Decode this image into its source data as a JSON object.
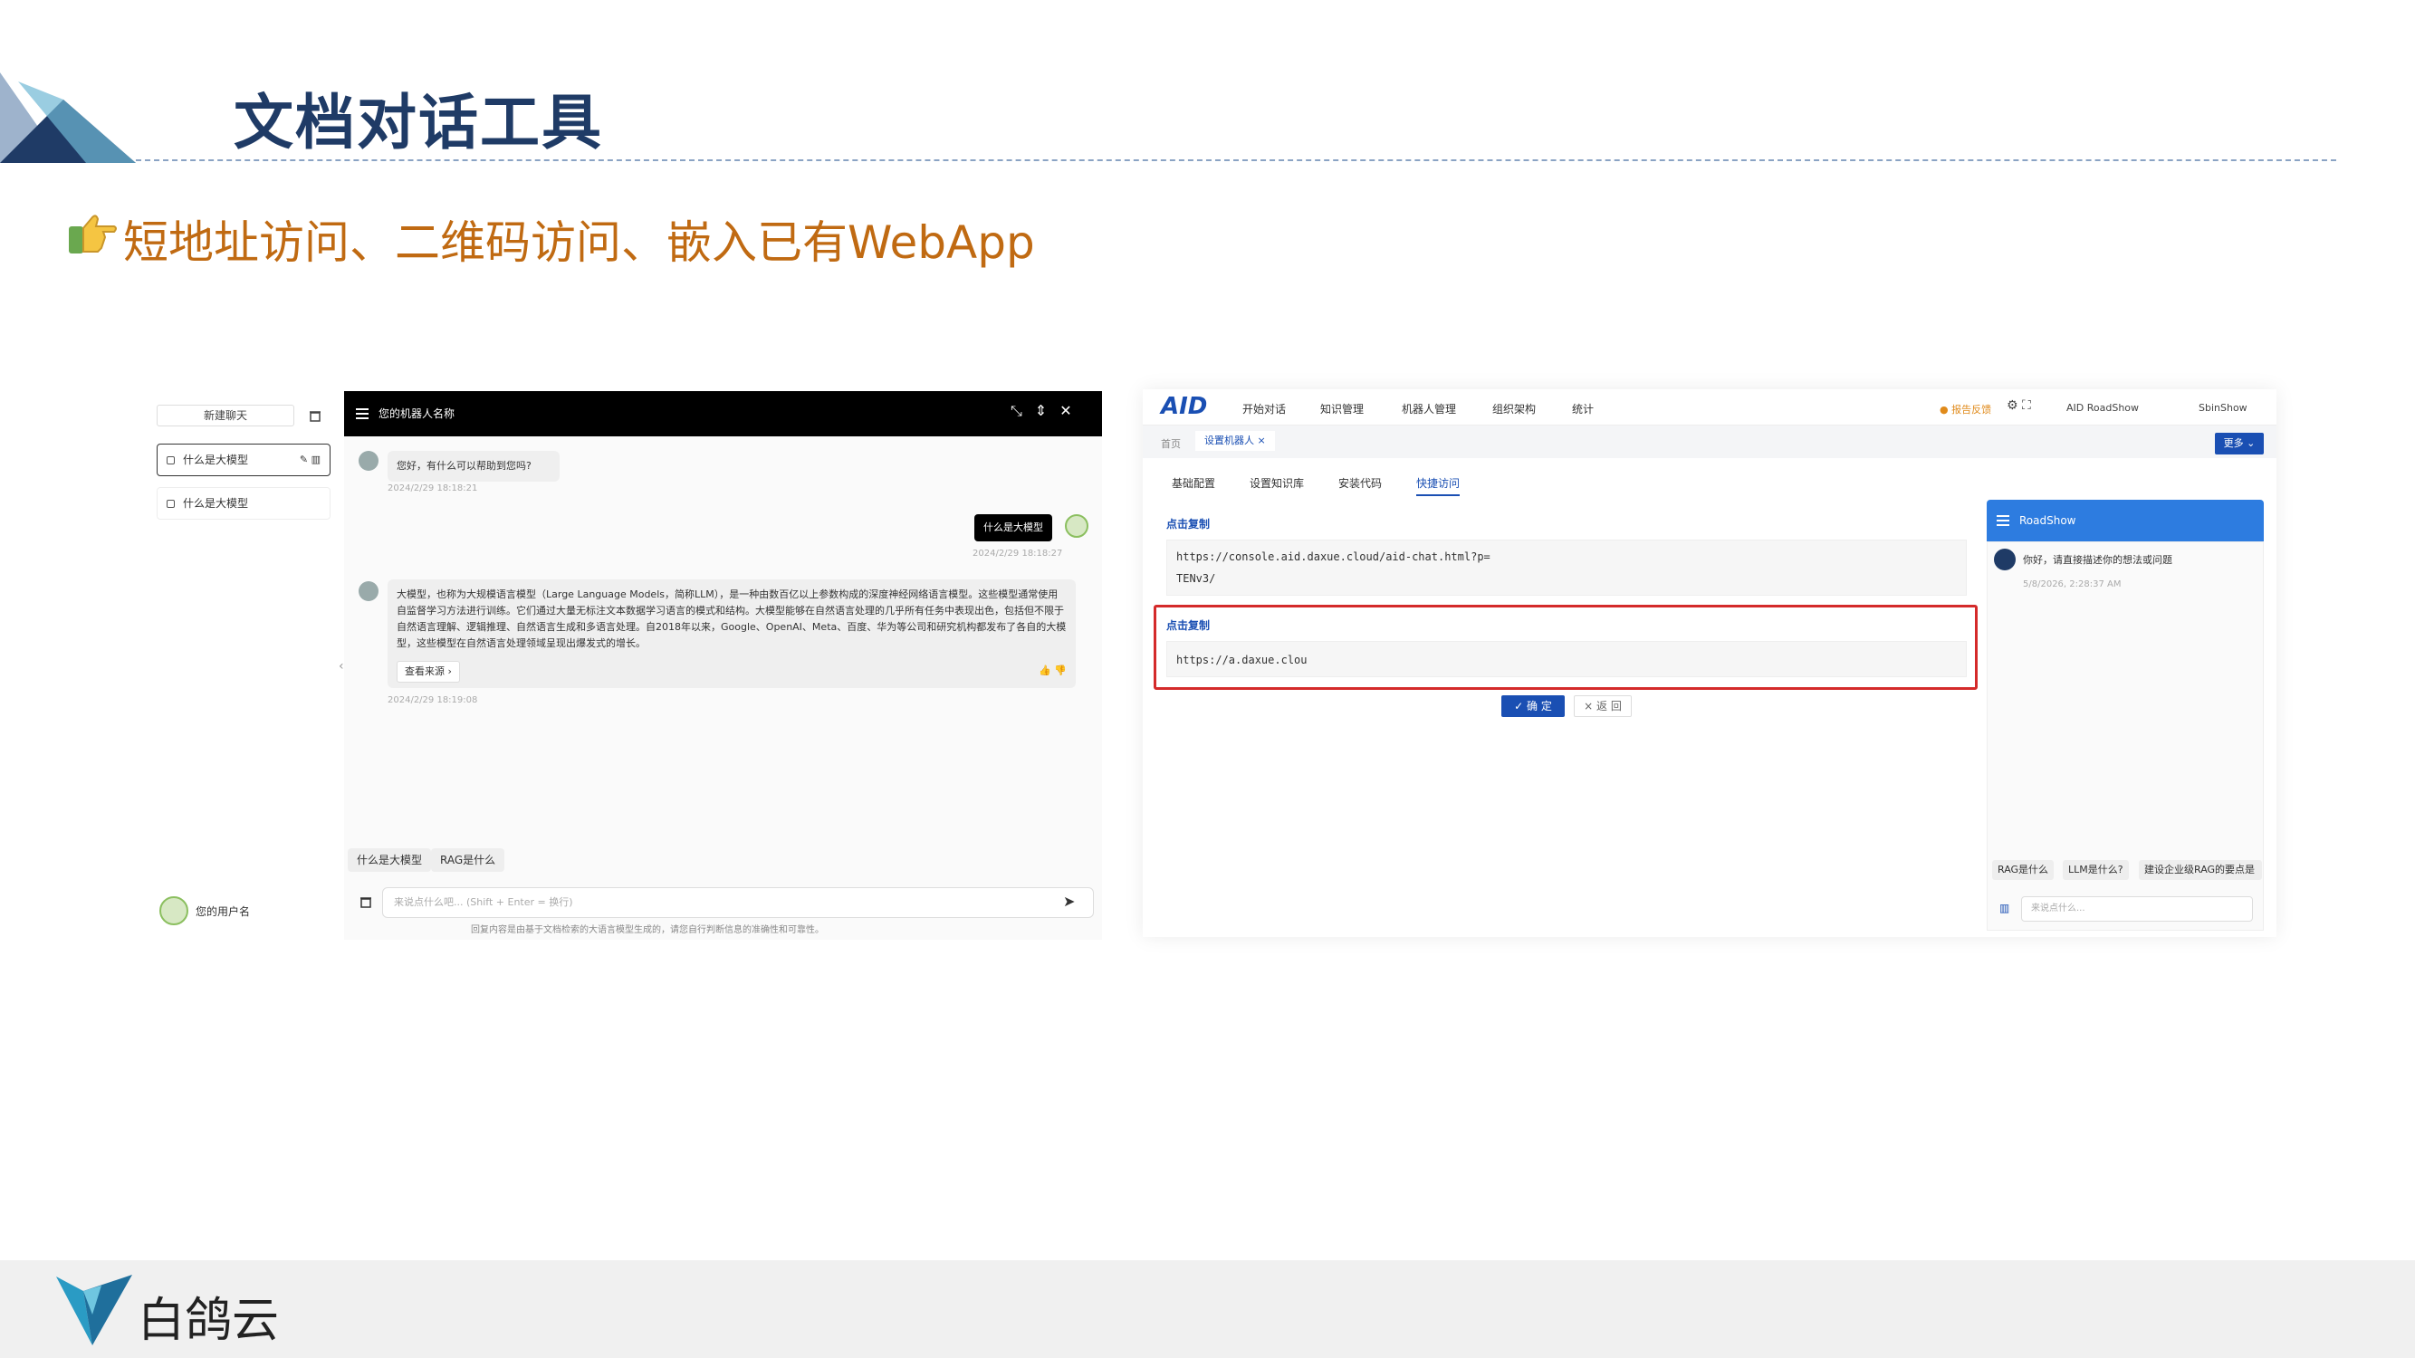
{
  "slide": {
    "title": "文档对话工具",
    "subtitle": "短地址访问、二维码访问、嵌入已有WebApp",
    "brand": "白鸽云"
  },
  "left_app": {
    "new_chat_label": "新建聊天",
    "history": [
      "什么是大模型",
      "什么是大模型"
    ],
    "bot_name": "您的机器人名称",
    "greeting": "您好，有什么可以帮助到您吗?",
    "greeting_time": "2024/2/29 18:18:21",
    "user_message": "什么是大模型",
    "user_time": "2024/2/29 18:18:27",
    "answer": "大模型，也称为大规模语言模型（Large Language Models，简称LLM），是一种由数百亿以上参数构成的深度神经网络语言模型。这些模型通常使用自监督学习方法进行训练。它们通过大量无标注文本数据学习语言的模式和结构。大模型能够在自然语言处理的几乎所有任务中表现出色，包括但不限于自然语言理解、逻辑推理、自然语言生成和多语言处理。自2018年以来，Google、OpenAI、Meta、百度、华为等公司和研究机构都发布了各自的大模型，这些模型在自然语言处理领域呈现出爆发式的增长。",
    "view_source": "查看来源 ›",
    "answer_time": "2024/2/29 18:19:08",
    "suggestions": [
      "什么是大模型",
      "RAG是什么"
    ],
    "username": "您的用户名",
    "input_placeholder": "来说点什么吧... (Shift + Enter = 换行)",
    "disclaimer": "回复内容是由基于文档检索的大语言模型生成的，请您自行判断信息的准确性和可靠性。"
  },
  "right_app": {
    "logo": "AID",
    "nav": [
      "开始对话",
      "知识管理",
      "机器人管理",
      "组织架构",
      "统计"
    ],
    "feedback": "● 报告反馈",
    "workspace": "AID RoadShow",
    "user": "SbinShow",
    "breadcrumb_home": "首页",
    "breadcrumb_tab": "设置机器人 ×",
    "more_button": "更多 ⌄",
    "config_tabs": [
      "基础配置",
      "设置知识库",
      "安装代码",
      "快捷访问"
    ],
    "copy_label_1": "点击复制",
    "long_url_1": "https://console.aid.daxue.cloud/aid-chat.html?p=",
    "long_url_2": "TENv3/",
    "copy_label_2": "点击复制",
    "short_url": "https://a.daxue.clou",
    "ok_button": "✓ 确 定",
    "back_button": "× 返 回",
    "preview_title": "RoadShow",
    "preview_greeting": "你好，请直接描述你的想法或问题",
    "preview_time": "5/8/2026, 2:28:37 AM",
    "preview_chips": [
      "RAG是什么",
      "LLM是什么?",
      "建设企业级RAG的要点是"
    ],
    "preview_placeholder": "来说点什么..."
  }
}
